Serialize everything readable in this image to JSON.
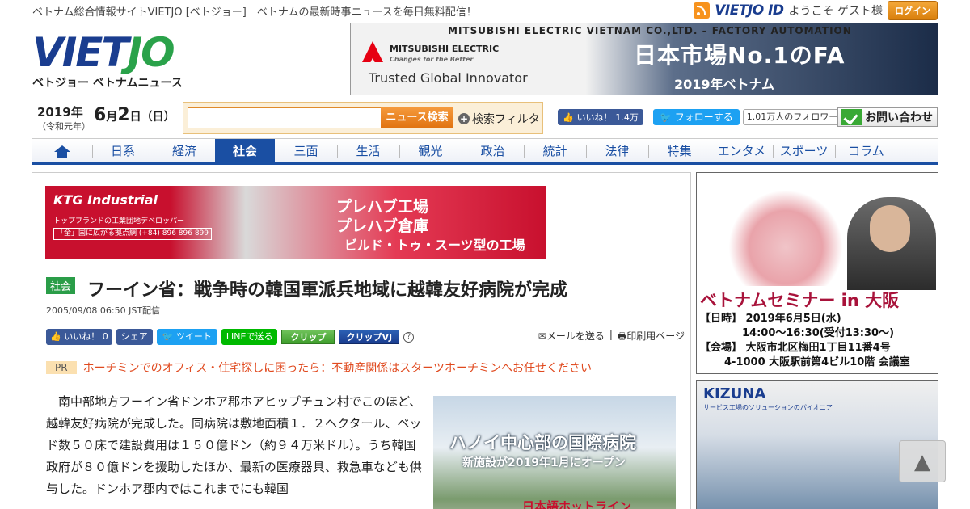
{
  "topbar": {
    "tagline": "ベトナム総合情報サイトVIETJO [ベトジョー]　ベトナムの最新時事ニュースを毎日無料配信！",
    "vjid": "VIETJO ID",
    "welcome": "ようこそ ゲスト様",
    "login": "ログイン"
  },
  "logo": {
    "main_a": "VIET",
    "main_b": "JO",
    "sub": "ベトジョー ベトナムニュース"
  },
  "header_ad": {
    "company": "MITSUBISHI ELECTRIC VIETNAM CO.,LTD. – FACTORY AUTOMATION",
    "brand": "MITSUBISHI ELECTRIC",
    "brand_tag": "Changes for the Better",
    "slogan": "Trusted Global Innovator",
    "headline": "日本市場No.1のFA",
    "sub": "2019年ベトナム"
  },
  "date": {
    "year": "2019年",
    "era": "（令和元年）",
    "month": "6",
    "month_unit": "月",
    "day": "2",
    "day_unit": "日",
    "weekday": "（日）"
  },
  "search": {
    "placeholder": "",
    "button": "ニュース検索",
    "filter": "検索フィルタ"
  },
  "social": {
    "fb_like": "いいね！",
    "fb_count": "1.4万",
    "tw_follow": "フォローする",
    "tw_followers": "1.01万人のフォロワー",
    "contact": "お問い合わせ"
  },
  "nav": {
    "items": [
      {
        "label": "日系"
      },
      {
        "label": "経済"
      },
      {
        "label": "社会"
      },
      {
        "label": "三面"
      },
      {
        "label": "生活"
      },
      {
        "label": "観光"
      },
      {
        "label": "政治"
      },
      {
        "label": "統計"
      },
      {
        "label": "法律"
      },
      {
        "label": "特集"
      },
      {
        "label": "エンタメ"
      },
      {
        "label": "スポーツ"
      },
      {
        "label": "コラム"
      }
    ],
    "active": "社会"
  },
  "ad_ktg": {
    "brand": "KTG Industrial",
    "tagline": "トップブランドの工業団地デベロッパー",
    "contact": "「全」国に広がる拠点網 (+84) 896 896 899",
    "headline1": "プレハブ工場",
    "headline2": "プレハブ倉庫",
    "headline3": "ビルド・トゥ・スーツ型の工場"
  },
  "article": {
    "category": "社会",
    "title": "フーイン省：戦争時の韓国軍派兵地域に越韓友好病院が完成",
    "published": "2005/09/08 06:50 JST配信",
    "body": "南中部地方フーイン省ドンホア郡ホアヒップチュン村でこのほど、越韓友好病院が完成した。同病院は敷地面積１．２ヘクタール、ベッド数５０床で建設費用は１５０億ドン（約９４万米ドル）。うち韓国政府が８０億ドンを援助したほか、最新の医療器具、救急車なども供与した。ドンホア郡内ではこれまでにも韓国"
  },
  "share": {
    "fb_like": "いいね！",
    "fb_count": "0",
    "share": "シェア",
    "tweet": "ツイート",
    "line": "LINEで送る",
    "clip": "クリップ",
    "clip_vj": "クリップVJ",
    "help": "?",
    "mail": "メールを送る",
    "separator": "|",
    "print": "印刷用ページ"
  },
  "pr": {
    "tag": "PR",
    "text": "ホーチミンでのオフィス・住宅探しに困ったら：不動産関係はスターツホーチミンへお任せください"
  },
  "ad_hospital": {
    "headline": "ハノイ中心部の国際病院",
    "sub": "新施設が2019年1月にオープン",
    "hotline": "日本語ホットライン"
  },
  "ad_seminar": {
    "title": "ベトナムセミナー in 大阪",
    "date_line": "【日時】 2019年6月5日(水)",
    "time_line": "14:00～16:30(受付13:30～)",
    "place_line": "【会場】 大阪市北区梅田1丁目11番4号",
    "place_line2": "4-1000 大阪駅前第4ビル10階 会議室"
  },
  "ad_kizuna": {
    "brand": "KIZUNA",
    "tagline": "サービス工場のソリューションのパイオニア"
  },
  "totop": "▲",
  "colors": {
    "brand_blue": "#1a4fa3",
    "accent_orange": "#e0720f",
    "category_green": "#2a9d48"
  }
}
